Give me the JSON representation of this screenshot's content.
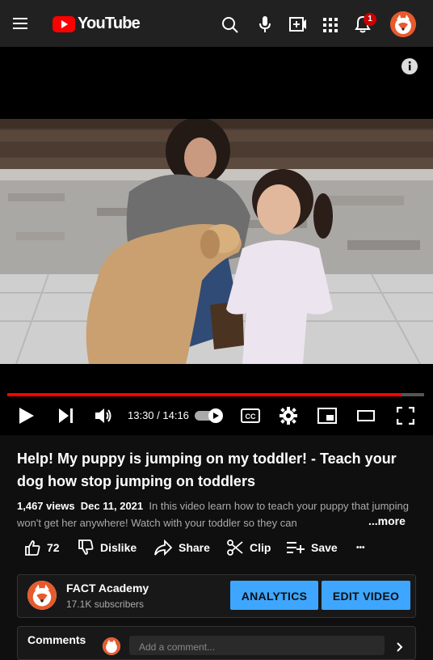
{
  "header": {
    "logo_text": "YouTube",
    "notification_count": "1",
    "icons": [
      "menu-icon",
      "search-icon",
      "mic-icon",
      "create-icon",
      "apps-icon",
      "bell-icon"
    ]
  },
  "player": {
    "current_time": "13:30",
    "duration": "14:16",
    "time_display": "13:30 / 14:16",
    "progress_fraction": 0.945,
    "cc_label": "CC"
  },
  "video": {
    "title": "Help! My puppy is jumping on my toddler! - Teach your dog how stop jumping on toddlers",
    "views": "1,467 views",
    "date": "Dec 11, 2021",
    "description": "In this video learn how to teach your puppy that jumping won't get her anywhere! Watch with your toddler so they can",
    "more_label": "...more"
  },
  "actions": {
    "like_count": "72",
    "dislike_label": "Dislike",
    "share_label": "Share",
    "clip_label": "Clip",
    "save_label": "Save",
    "overflow": "•••"
  },
  "channel": {
    "name": "FACT Academy",
    "subscribers": "17.1K subscribers",
    "analytics_label": "ANALYTICS",
    "edit_label": "EDIT VIDEO"
  },
  "comments": {
    "label": "Comments",
    "placeholder": "Add a comment..."
  },
  "colors": {
    "brand_red": "#ff0000",
    "accent_blue": "#3ea6ff",
    "background": "#0f0f0f"
  }
}
